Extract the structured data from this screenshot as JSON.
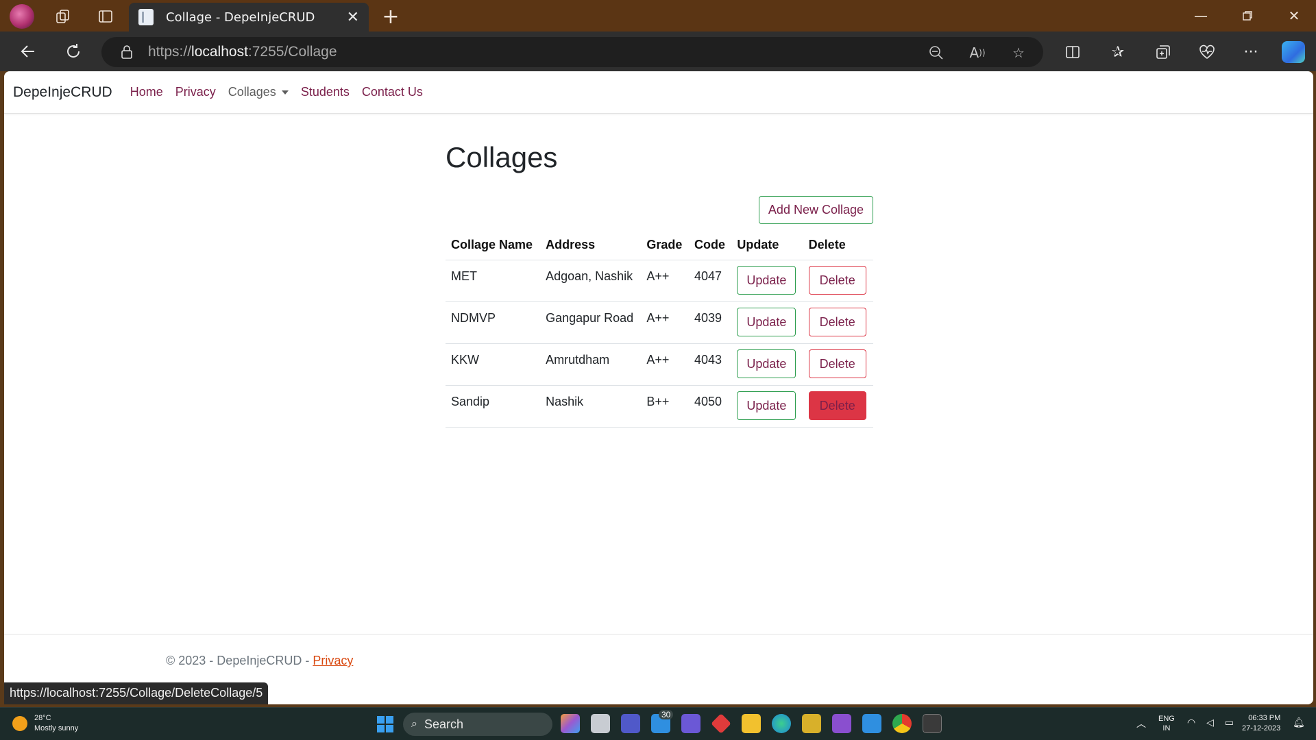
{
  "browser": {
    "tab_title": "Collage - DepeInjeCRUD",
    "url_prefix": "https://",
    "url_host": "localhost",
    "url_rest": ":7255/Collage",
    "status_url": "https://localhost:7255/Collage/DeleteCollage/5"
  },
  "navbar": {
    "brand": "DepeInjeCRUD",
    "links": [
      "Home",
      "Privacy",
      "Collages",
      "Students",
      "Contact Us"
    ]
  },
  "main": {
    "title": "Collages",
    "add_button": "Add New Collage",
    "columns": [
      "Collage Name",
      "Address",
      "Grade",
      "Code",
      "Update",
      "Delete"
    ],
    "rows": [
      {
        "name": "MET",
        "address": "Adgoan, Nashik",
        "grade": "A++",
        "code": "4047",
        "update": "Update",
        "delete": "Delete"
      },
      {
        "name": "NDMVP",
        "address": "Gangapur Road",
        "grade": "A++",
        "code": "4039",
        "update": "Update",
        "delete": "Delete"
      },
      {
        "name": "KKW",
        "address": "Amrutdham",
        "grade": "A++",
        "code": "4043",
        "update": "Update",
        "delete": "Delete"
      },
      {
        "name": "Sandip",
        "address": "Nashik",
        "grade": "B++",
        "code": "4050",
        "update": "Update",
        "delete": "Delete"
      }
    ]
  },
  "footer": {
    "text": "© 2023 - DepeInjeCRUD - ",
    "link": "Privacy"
  },
  "taskbar": {
    "temperature": "28°C",
    "weather": "Mostly sunny",
    "search": "Search",
    "mail_badge": "30",
    "lang_line1": "ENG",
    "lang_line2": "IN",
    "time": "06:33 PM",
    "date": "27-12-2023"
  },
  "colors": {
    "link": "#7a1f4a",
    "success_border": "#2e9e4f",
    "danger": "#dc3545",
    "titlebar": "#5b3514"
  }
}
